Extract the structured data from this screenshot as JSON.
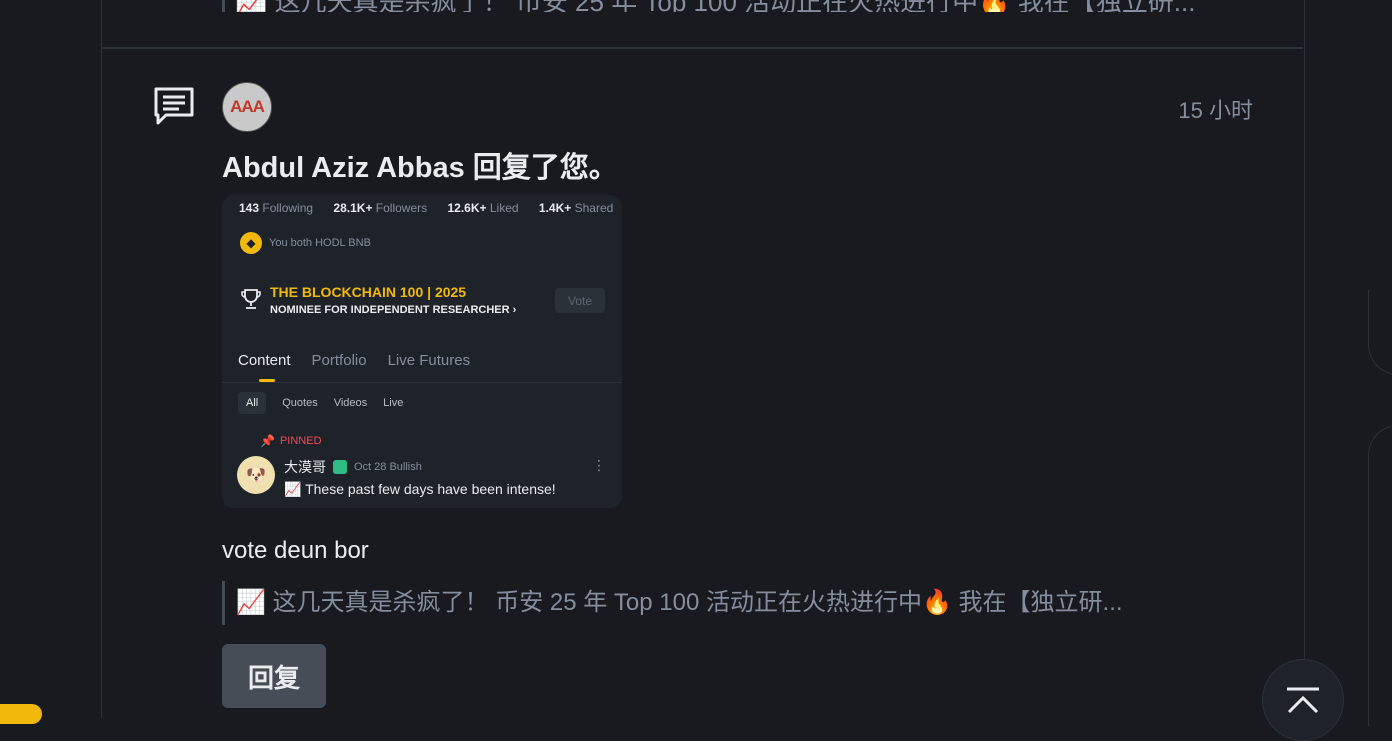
{
  "previous_item": {
    "snippet": "📈 这几天真是杀疯了！ 币安 25 年 Top 100 活动正在火热进行中🔥 我在【独立研..."
  },
  "notification": {
    "type_icon": "message-icon",
    "avatar_text": "AAA",
    "time": "15 小时",
    "title": "Abdul Aziz Abbas 回复了您。",
    "reply_text": "vote deun bor",
    "quoted_text": "📈 这几天真是杀疯了！ 币安 25 年 Top 100 活动正在火热进行中🔥 我在【独立研...",
    "reply_button_label": "回复"
  },
  "embedded_screenshot": {
    "stats": [
      {
        "value": "143",
        "label": "Following"
      },
      {
        "value": "28.1K+",
        "label": "Followers"
      },
      {
        "value": "12.6K+",
        "label": "Liked"
      },
      {
        "value": "1.4K+",
        "label": "Shared"
      }
    ],
    "hodl_text": "You both HODL BNB",
    "award_title": "THE BLOCKCHAIN 100 | 2025",
    "award_subtitle": "NOMINEE FOR INDEPENDENT RESEARCHER",
    "vote_label": "Vote",
    "tabs": [
      "Content",
      "Portfolio",
      "Live Futures"
    ],
    "active_tab": "Content",
    "subtabs": [
      "All",
      "Quotes",
      "Videos",
      "Live"
    ],
    "pinned_label": "PINNED",
    "post": {
      "author": "大漠哥",
      "meta": "Oct 28  Bullish",
      "text": "📈 These past few days have been intense!"
    }
  },
  "colors": {
    "background": "#181a20",
    "accent": "#f0b90b",
    "muted_text": "#848e9c",
    "button": "#474d57"
  }
}
